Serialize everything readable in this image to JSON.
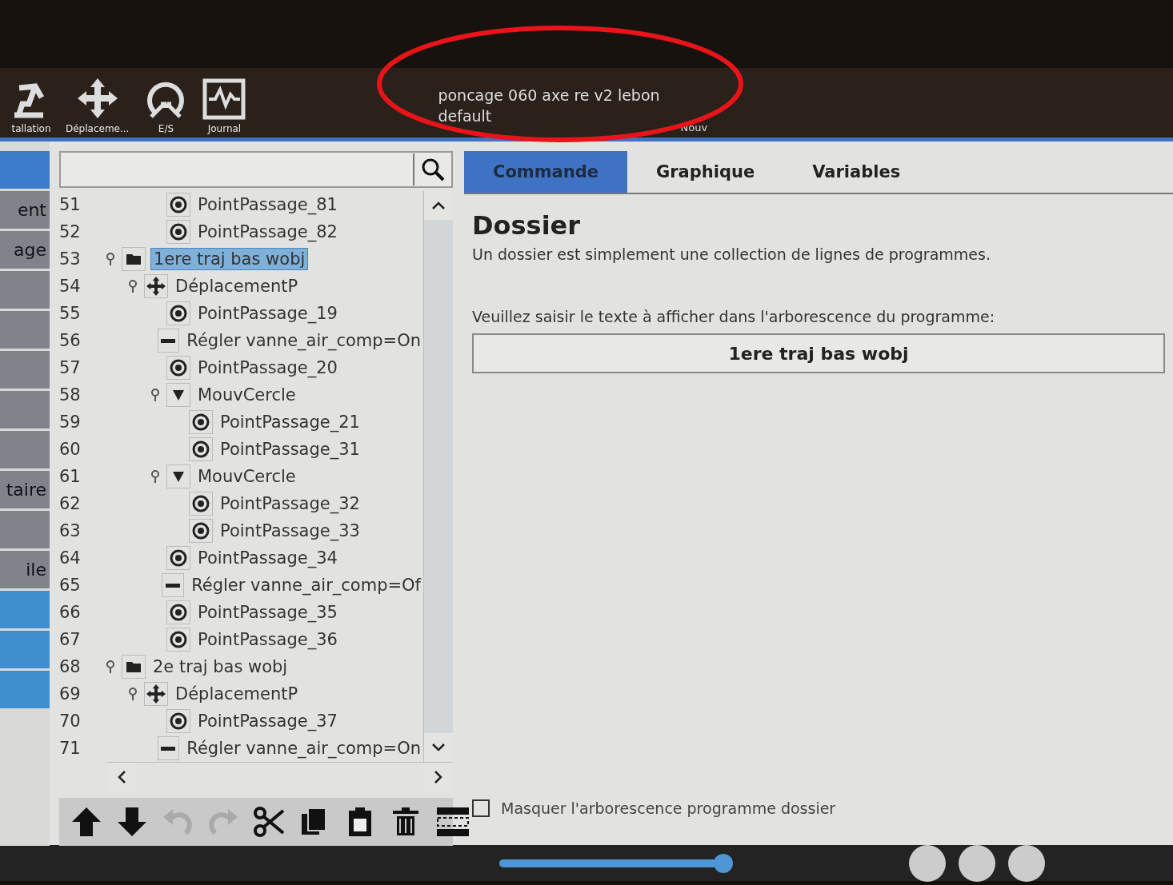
{
  "header": {
    "tools": [
      {
        "kind": "robot",
        "label": "tallation"
      },
      {
        "kind": "move",
        "label": "Déplaceme..."
      },
      {
        "kind": "io",
        "label": "E/S"
      },
      {
        "kind": "log",
        "label": "Journal"
      }
    ],
    "program_name": "poncage 060 axe re v2 lebon",
    "installation_name": "default",
    "new_button": "Nouv"
  },
  "side_tabs": [
    {
      "color": "#3d7cc9"
    },
    {
      "label": "ent",
      "color": "#80848a"
    },
    {
      "label": "age",
      "color": "#80848a"
    },
    {
      "color": "#80848a"
    },
    {
      "color": "#80848a"
    },
    {
      "color": "#80848a"
    },
    {
      "color": "#80848a"
    },
    {
      "color": "#80848a"
    },
    {
      "label": "taire",
      "color": "#80848a"
    },
    {
      "color": "#80848a"
    },
    {
      "label": "ile",
      "color": "#80848a"
    },
    {
      "color": "#3d8fd0"
    },
    {
      "color": "#3d8fd0"
    },
    {
      "color": "#3d8fd0"
    }
  ],
  "tree": [
    {
      "kind": "offscreen",
      "children": [
        {
          "kind": "offscreen",
          "children": [
            {
              "line": "51",
              "kind": "waypoint",
              "label": "PointPassage_81",
              "selected": false
            },
            {
              "line": "52",
              "kind": "waypoint",
              "label": "PointPassage_82",
              "selected": false
            }
          ]
        }
      ]
    },
    {
      "line": "53",
      "kind": "folder",
      "label": "1ere traj bas wobj",
      "selected": true,
      "children": [
        {
          "line": "54",
          "kind": "move",
          "label": "DéplacementP",
          "selected": false,
          "children": [
            {
              "line": "55",
              "kind": "waypoint",
              "label": "PointPassage_19",
              "selected": false
            },
            {
              "line": "56",
              "kind": "set",
              "label": "Régler vanne_air_comp=On",
              "selected": false
            },
            {
              "line": "57",
              "kind": "waypoint",
              "label": "PointPassage_20",
              "selected": false
            },
            {
              "line": "58",
              "kind": "circle",
              "label": "MouvCercle",
              "selected": false,
              "children": [
                {
                  "line": "59",
                  "kind": "waypoint",
                  "label": "PointPassage_21",
                  "selected": false
                },
                {
                  "line": "60",
                  "kind": "waypoint",
                  "label": "PointPassage_31",
                  "selected": false
                }
              ]
            },
            {
              "line": "61",
              "kind": "circle",
              "label": "MouvCercle",
              "selected": false,
              "children": [
                {
                  "line": "62",
                  "kind": "waypoint",
                  "label": "PointPassage_32",
                  "selected": false
                },
                {
                  "line": "63",
                  "kind": "waypoint",
                  "label": "PointPassage_33",
                  "selected": false
                }
              ]
            },
            {
              "line": "64",
              "kind": "waypoint",
              "label": "PointPassage_34",
              "selected": false
            },
            {
              "line": "65",
              "kind": "set",
              "label": "Régler vanne_air_comp=Of",
              "selected": false
            },
            {
              "line": "66",
              "kind": "waypoint",
              "label": "PointPassage_35",
              "selected": false
            },
            {
              "line": "67",
              "kind": "waypoint",
              "label": "PointPassage_36",
              "selected": false
            }
          ]
        }
      ]
    },
    {
      "line": "68",
      "kind": "folder",
      "label": "2e traj bas wobj",
      "selected": false,
      "children": [
        {
          "line": "69",
          "kind": "move",
          "label": "DéplacementP",
          "selected": false,
          "children": [
            {
              "line": "70",
              "kind": "waypoint",
              "label": "PointPassage_37",
              "selected": false
            },
            {
              "line": "71",
              "kind": "set",
              "label": "Régler vanne_air_comp=On",
              "selected": false
            }
          ]
        }
      ]
    }
  ],
  "editor_toolbar": [
    {
      "kind": "up",
      "disabled": false
    },
    {
      "kind": "down",
      "disabled": false
    },
    {
      "kind": "undo",
      "disabled": true
    },
    {
      "kind": "redo",
      "disabled": true
    },
    {
      "kind": "cut",
      "disabled": false
    },
    {
      "kind": "copy",
      "disabled": false
    },
    {
      "kind": "paste",
      "disabled": false
    },
    {
      "kind": "delete",
      "disabled": false
    },
    {
      "kind": "suppress",
      "disabled": false
    }
  ],
  "tabs": [
    {
      "label": "Commande",
      "selected": true
    },
    {
      "label": "Graphique",
      "selected": false
    },
    {
      "label": "Variables",
      "selected": false
    }
  ],
  "panel": {
    "title": "Dossier",
    "description": "Un dossier est simplement une collection de lignes de programmes.",
    "prompt": "Veuillez saisir le texte à afficher dans l'arborescence du programme:",
    "value": "1ere traj bas wobj",
    "hide_option": {
      "label": "Masquer l'arborescence programme dossier",
      "checked": false
    }
  },
  "footer": {
    "speed": {
      "level": 1
    }
  }
}
